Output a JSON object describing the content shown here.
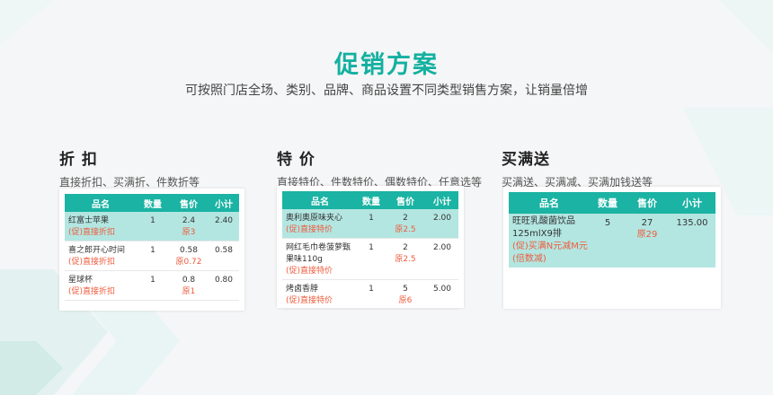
{
  "header": {
    "title": "促销方案",
    "subtitle": "可按照门店全场、类别、品牌、商品设置不同类型销售方案，让销量倍增"
  },
  "sections": [
    {
      "title": "折 扣",
      "desc": "直接折扣、买满折、件数折等",
      "columns": [
        "品名",
        "数量",
        "售价",
        "小计"
      ],
      "rows": [
        {
          "name": "红富士苹果",
          "promo": "(促)直接折扣",
          "qty": "1",
          "price": "2.4",
          "orig": "原3",
          "subtotal": "2.40",
          "highlight": true
        },
        {
          "name": "喜之郎开心时间",
          "promo": "(促)直接折扣",
          "qty": "1",
          "price": "0.58",
          "orig": "原0.72",
          "subtotal": "0.58",
          "highlight": false
        },
        {
          "name": "星球杯",
          "promo": "(促)直接折扣",
          "qty": "1",
          "price": "0.8",
          "orig": "原1",
          "subtotal": "0.80",
          "highlight": false
        }
      ]
    },
    {
      "title": "特 价",
      "desc": "直接特价、件数特价、偶数特价、任意选等",
      "columns": [
        "品名",
        "数量",
        "售价",
        "小计"
      ],
      "rows": [
        {
          "name": "奥利奥原味夹心",
          "promo": "(促)直接特价",
          "qty": "1",
          "price": "2",
          "orig": "原2.5",
          "subtotal": "2.00",
          "highlight": true
        },
        {
          "name": "网红毛巾卷菠萝甄果味110g",
          "promo": "(促)直接特价",
          "qty": "1",
          "price": "2",
          "orig": "原2.5",
          "subtotal": "2.00",
          "highlight": false
        },
        {
          "name": "烤卤香脖",
          "promo": "(促)直接特价",
          "qty": "1",
          "price": "5",
          "orig": "原6",
          "subtotal": "5.00",
          "highlight": false
        }
      ]
    },
    {
      "title": "买满送",
      "desc": "买满送、买满减、买满加钱送等",
      "columns": [
        "品名",
        "数量",
        "售价",
        "小计"
      ],
      "rows": [
        {
          "name": "旺旺乳酸菌饮品125mlX9排",
          "promo": "(促)买满N元减M元(倍数减)",
          "qty": "5",
          "price": "27",
          "orig": "原29",
          "subtotal": "135.00",
          "highlight": true
        }
      ]
    }
  ],
  "colors": {
    "accent": "#13b0a0",
    "header_bg": "#1bb3a3",
    "highlight_row": "#b3e6e1",
    "promo_text": "#ee5b3c"
  }
}
